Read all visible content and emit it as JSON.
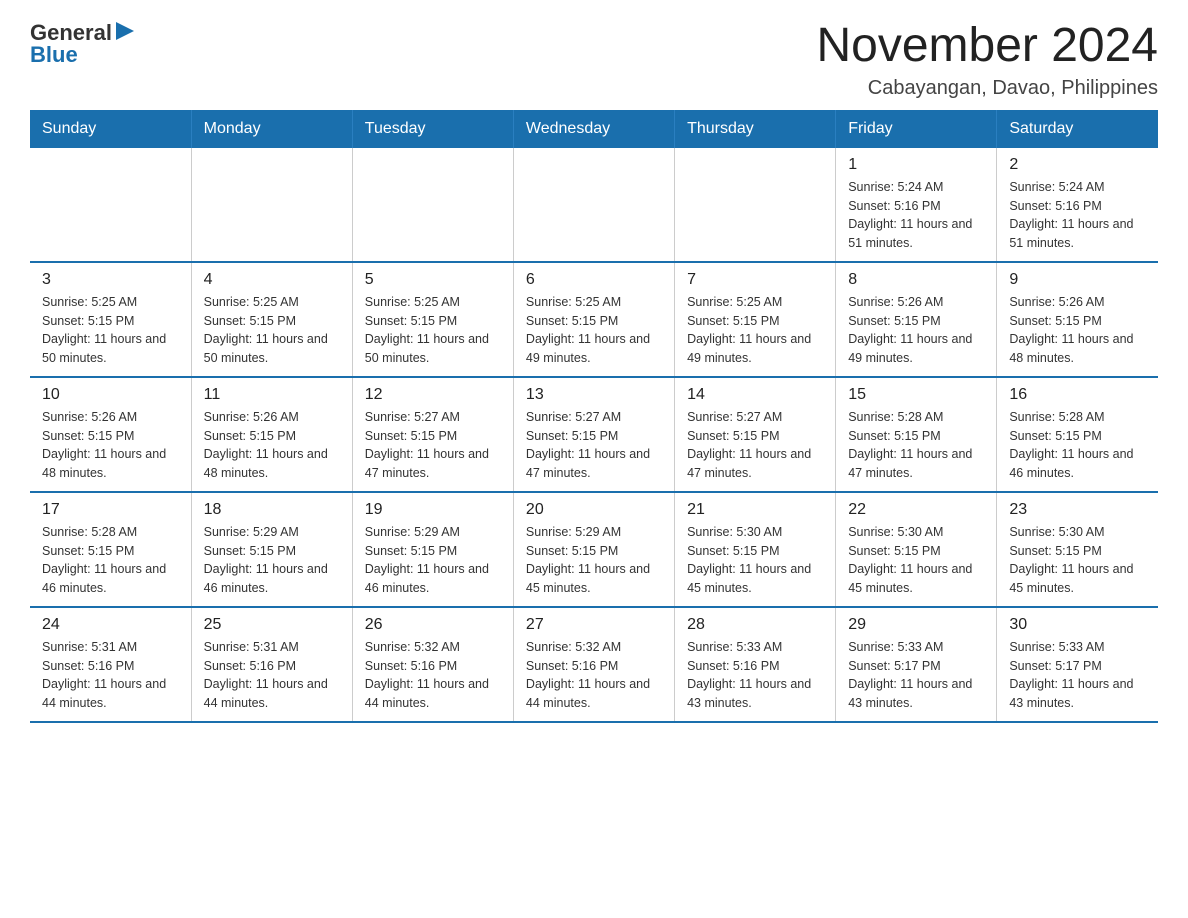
{
  "header": {
    "logo": {
      "general": "General",
      "blue": "Blue",
      "arrow_icon": "▶"
    },
    "title": "November 2024",
    "location": "Cabayangan, Davao, Philippines"
  },
  "days_of_week": [
    "Sunday",
    "Monday",
    "Tuesday",
    "Wednesday",
    "Thursday",
    "Friday",
    "Saturday"
  ],
  "weeks": [
    {
      "days": [
        {
          "number": "",
          "info": ""
        },
        {
          "number": "",
          "info": ""
        },
        {
          "number": "",
          "info": ""
        },
        {
          "number": "",
          "info": ""
        },
        {
          "number": "",
          "info": ""
        },
        {
          "number": "1",
          "info": "Sunrise: 5:24 AM\nSunset: 5:16 PM\nDaylight: 11 hours and 51 minutes."
        },
        {
          "number": "2",
          "info": "Sunrise: 5:24 AM\nSunset: 5:16 PM\nDaylight: 11 hours and 51 minutes."
        }
      ]
    },
    {
      "days": [
        {
          "number": "3",
          "info": "Sunrise: 5:25 AM\nSunset: 5:15 PM\nDaylight: 11 hours and 50 minutes."
        },
        {
          "number": "4",
          "info": "Sunrise: 5:25 AM\nSunset: 5:15 PM\nDaylight: 11 hours and 50 minutes."
        },
        {
          "number": "5",
          "info": "Sunrise: 5:25 AM\nSunset: 5:15 PM\nDaylight: 11 hours and 50 minutes."
        },
        {
          "number": "6",
          "info": "Sunrise: 5:25 AM\nSunset: 5:15 PM\nDaylight: 11 hours and 49 minutes."
        },
        {
          "number": "7",
          "info": "Sunrise: 5:25 AM\nSunset: 5:15 PM\nDaylight: 11 hours and 49 minutes."
        },
        {
          "number": "8",
          "info": "Sunrise: 5:26 AM\nSunset: 5:15 PM\nDaylight: 11 hours and 49 minutes."
        },
        {
          "number": "9",
          "info": "Sunrise: 5:26 AM\nSunset: 5:15 PM\nDaylight: 11 hours and 48 minutes."
        }
      ]
    },
    {
      "days": [
        {
          "number": "10",
          "info": "Sunrise: 5:26 AM\nSunset: 5:15 PM\nDaylight: 11 hours and 48 minutes."
        },
        {
          "number": "11",
          "info": "Sunrise: 5:26 AM\nSunset: 5:15 PM\nDaylight: 11 hours and 48 minutes."
        },
        {
          "number": "12",
          "info": "Sunrise: 5:27 AM\nSunset: 5:15 PM\nDaylight: 11 hours and 47 minutes."
        },
        {
          "number": "13",
          "info": "Sunrise: 5:27 AM\nSunset: 5:15 PM\nDaylight: 11 hours and 47 minutes."
        },
        {
          "number": "14",
          "info": "Sunrise: 5:27 AM\nSunset: 5:15 PM\nDaylight: 11 hours and 47 minutes."
        },
        {
          "number": "15",
          "info": "Sunrise: 5:28 AM\nSunset: 5:15 PM\nDaylight: 11 hours and 47 minutes."
        },
        {
          "number": "16",
          "info": "Sunrise: 5:28 AM\nSunset: 5:15 PM\nDaylight: 11 hours and 46 minutes."
        }
      ]
    },
    {
      "days": [
        {
          "number": "17",
          "info": "Sunrise: 5:28 AM\nSunset: 5:15 PM\nDaylight: 11 hours and 46 minutes."
        },
        {
          "number": "18",
          "info": "Sunrise: 5:29 AM\nSunset: 5:15 PM\nDaylight: 11 hours and 46 minutes."
        },
        {
          "number": "19",
          "info": "Sunrise: 5:29 AM\nSunset: 5:15 PM\nDaylight: 11 hours and 46 minutes."
        },
        {
          "number": "20",
          "info": "Sunrise: 5:29 AM\nSunset: 5:15 PM\nDaylight: 11 hours and 45 minutes."
        },
        {
          "number": "21",
          "info": "Sunrise: 5:30 AM\nSunset: 5:15 PM\nDaylight: 11 hours and 45 minutes."
        },
        {
          "number": "22",
          "info": "Sunrise: 5:30 AM\nSunset: 5:15 PM\nDaylight: 11 hours and 45 minutes."
        },
        {
          "number": "23",
          "info": "Sunrise: 5:30 AM\nSunset: 5:15 PM\nDaylight: 11 hours and 45 minutes."
        }
      ]
    },
    {
      "days": [
        {
          "number": "24",
          "info": "Sunrise: 5:31 AM\nSunset: 5:16 PM\nDaylight: 11 hours and 44 minutes."
        },
        {
          "number": "25",
          "info": "Sunrise: 5:31 AM\nSunset: 5:16 PM\nDaylight: 11 hours and 44 minutes."
        },
        {
          "number": "26",
          "info": "Sunrise: 5:32 AM\nSunset: 5:16 PM\nDaylight: 11 hours and 44 minutes."
        },
        {
          "number": "27",
          "info": "Sunrise: 5:32 AM\nSunset: 5:16 PM\nDaylight: 11 hours and 44 minutes."
        },
        {
          "number": "28",
          "info": "Sunrise: 5:33 AM\nSunset: 5:16 PM\nDaylight: 11 hours and 43 minutes."
        },
        {
          "number": "29",
          "info": "Sunrise: 5:33 AM\nSunset: 5:17 PM\nDaylight: 11 hours and 43 minutes."
        },
        {
          "number": "30",
          "info": "Sunrise: 5:33 AM\nSunset: 5:17 PM\nDaylight: 11 hours and 43 minutes."
        }
      ]
    }
  ]
}
